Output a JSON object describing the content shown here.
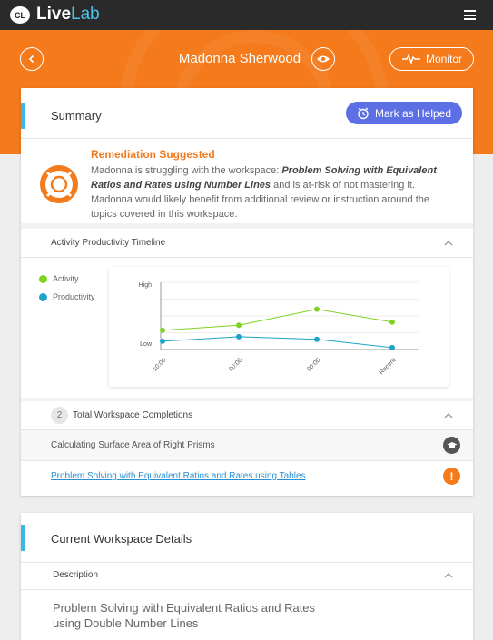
{
  "app": {
    "logo_badge": "CL",
    "logo_part1": "Live",
    "logo_part2": "Lab",
    "menu_icon": "hamburger-menu-icon"
  },
  "header": {
    "student_name": "Madonna Sherwood",
    "monitor_label": "Monitor",
    "accent_color": "#f47a1c"
  },
  "summary": {
    "title": "Summary",
    "mark_helped_label": "Mark as Helped",
    "remediation_title": "Remediation Suggested",
    "remediation_text_1": "Madonna is struggling with the workspace: ",
    "remediation_workspace": "Problem Solving with Equivalent Ratios and Rates using Number Lines",
    "remediation_text_2": " and is at-risk of not mastering it. Madonna would likely benefit from additional review or instruction around the topics covered in this workspace."
  },
  "timeline": {
    "label": "Activity Productivity Timeline",
    "legend": [
      {
        "label": "Activity",
        "color": "#7ed321"
      },
      {
        "label": "Productivity",
        "color": "#1fa2c8"
      }
    ]
  },
  "chart_data": {
    "type": "line",
    "x": [
      "-10:00",
      "00:00",
      "00:00",
      "Recent"
    ],
    "y_tick_labels": [
      "High",
      "Low"
    ],
    "series": [
      {
        "name": "Activity",
        "color": "#7ed321",
        "values": [
          0.25,
          0.33,
          0.58,
          0.38
        ]
      },
      {
        "name": "Productivity",
        "color": "#1fa2c8",
        "values": [
          0.08,
          0.15,
          0.11,
          -0.02
        ]
      }
    ],
    "ylim": [
      -0.05,
      1.0
    ],
    "grid": true
  },
  "completions": {
    "count": "2",
    "label": "Total Workspace Completions",
    "items": [
      {
        "label": "Calculating Surface Area of Right Prisms",
        "status_icon": "graduation-cap-icon",
        "is_link": false
      },
      {
        "label": "Problem Solving with Equivalent Ratios and Rates using Tables",
        "status_icon": "exclamation-icon",
        "is_link": true
      }
    ]
  },
  "details": {
    "title": "Current Workspace Details",
    "description_label": "Description",
    "description_text": "Problem Solving with Equivalent Ratios and Rates using Double Number Lines"
  }
}
